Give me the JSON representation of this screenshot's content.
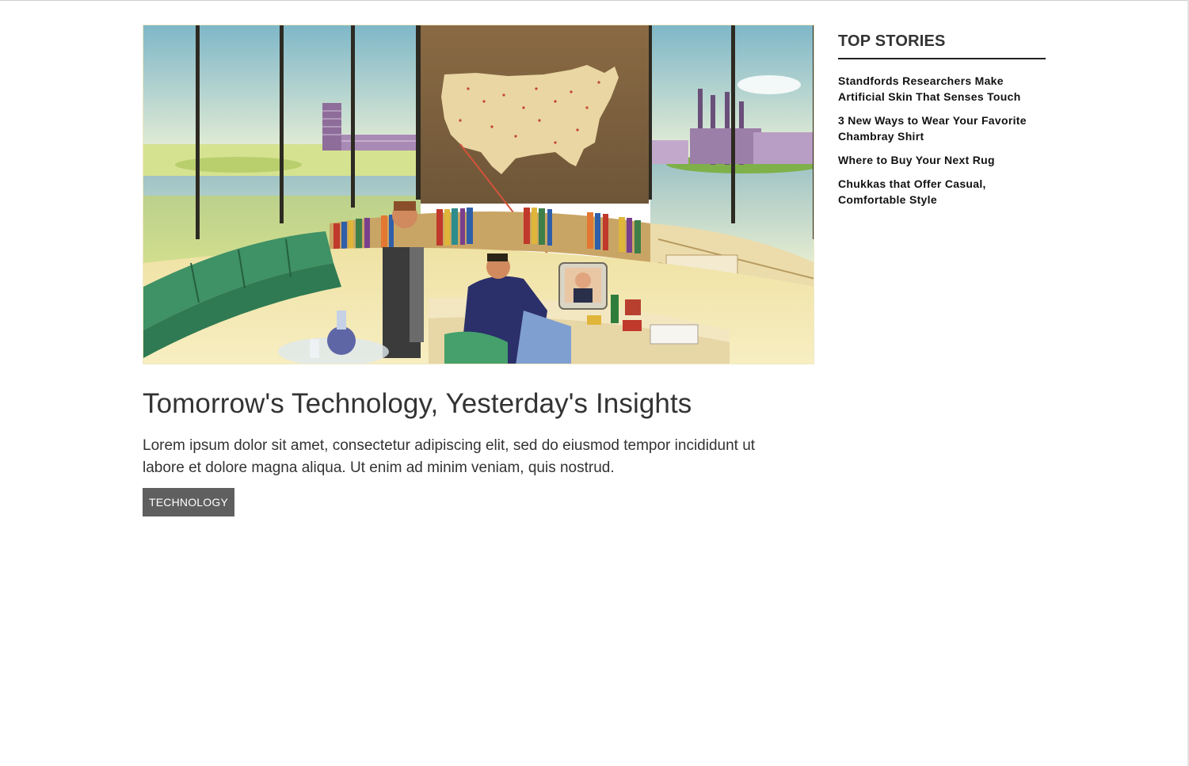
{
  "article": {
    "headline": "Tomorrow's Technology, Yesterday's Insights",
    "excerpt": "Lorem ipsum dolor sit amet, consectetur adipiscing elit, sed do eiusmod tempor incididunt ut labore et dolore magna aliqua. Ut enim ad minim veniam, quis nostrud.",
    "tag": "TECHNOLOGY",
    "image": "retro illustration of a futuristic control room with map of the United States"
  },
  "sidebar": {
    "title": "TOP STORIES",
    "stories": [
      {
        "title": "Standfords Researchers Make Artificial Skin That Senses Touch"
      },
      {
        "title": "3 New Ways to Wear Your Favorite Chambray Shirt"
      },
      {
        "title": "Where to Buy Your Next Rug"
      },
      {
        "title": "Chukkas that Offer Casual, Comfortable Style"
      }
    ]
  },
  "colors": {
    "tag_background": "#5f5f5f",
    "text": "#333333",
    "rule": "#222222"
  }
}
